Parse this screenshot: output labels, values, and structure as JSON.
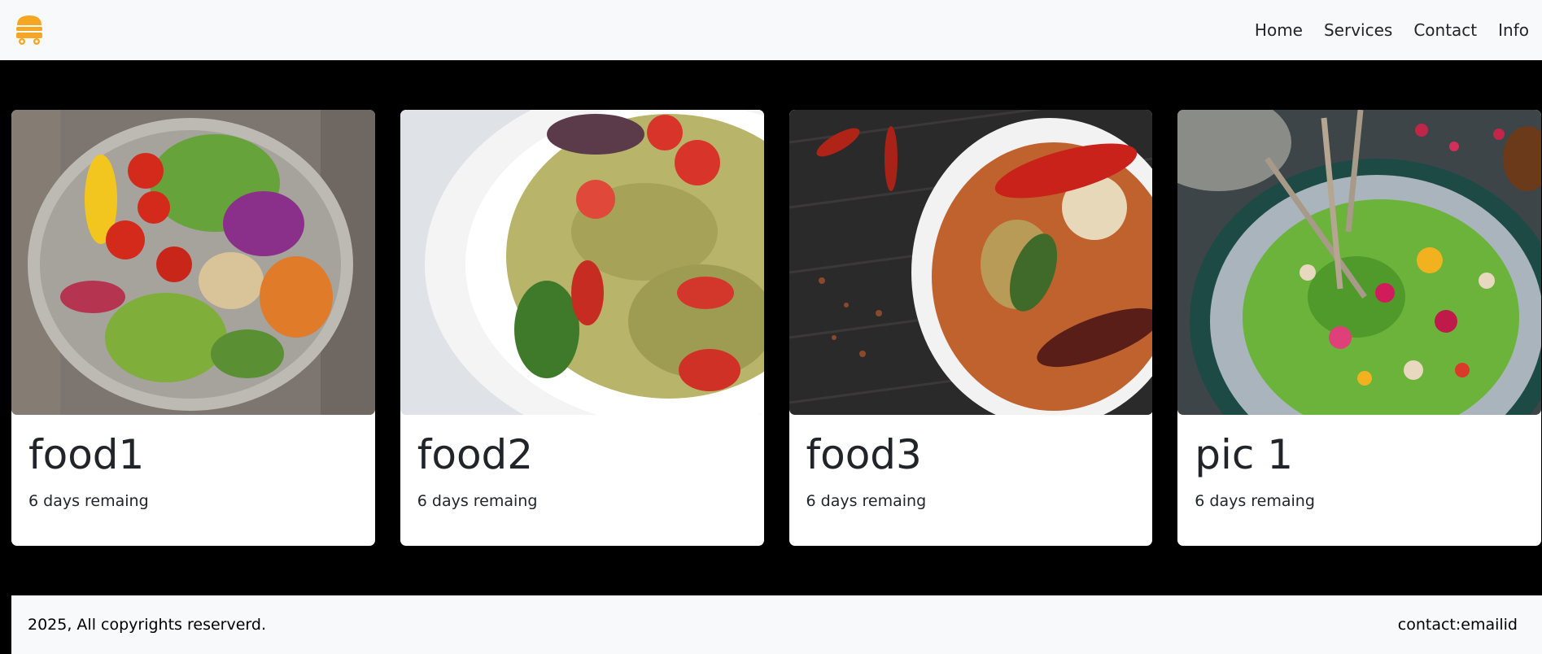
{
  "navbar": {
    "logo_icon": "food-truck-icon",
    "links": [
      "Home",
      "Services",
      "Contact",
      "Info"
    ]
  },
  "cards": [
    {
      "title": "food1",
      "text": "6 days remaing",
      "image": "salad-bowl-image"
    },
    {
      "title": "food2",
      "text": "6 days remaing",
      "image": "pasta-salad-image"
    },
    {
      "title": "food3",
      "text": "6 days remaing",
      "image": "curry-bowl-image"
    },
    {
      "title": "pic 1",
      "text": "6 days remaing",
      "image": "green-bowl-image"
    }
  ],
  "footer": {
    "copyright": "2025, All copyrights reserverd.",
    "contact": "contact:emailid"
  },
  "colors": {
    "background": "#000000",
    "navbar": "#f8f9fa",
    "logo": "#f5a623"
  }
}
